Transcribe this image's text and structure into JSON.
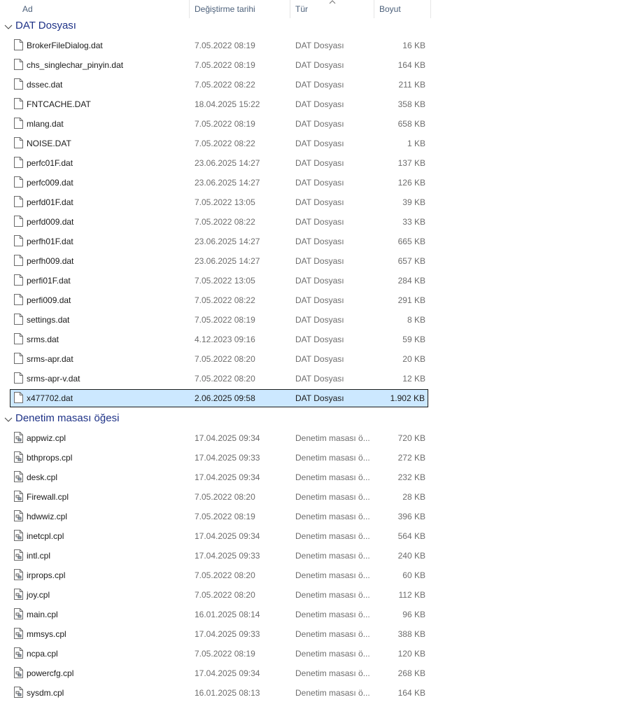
{
  "header": {
    "columns": [
      {
        "label": "Ad"
      },
      {
        "label": "Değiştirme tarihi"
      },
      {
        "label": "Tür"
      },
      {
        "label": "Boyut"
      }
    ]
  },
  "groups": [
    {
      "title": "DAT Dosyası",
      "icon": "file-icon",
      "files": [
        {
          "name": "BrokerFileDialog.dat",
          "date": "7.05.2022 08:19",
          "type": "DAT Dosyası",
          "size": "16 KB"
        },
        {
          "name": "chs_singlechar_pinyin.dat",
          "date": "7.05.2022 08:19",
          "type": "DAT Dosyası",
          "size": "164 KB"
        },
        {
          "name": "dssec.dat",
          "date": "7.05.2022 08:22",
          "type": "DAT Dosyası",
          "size": "211 KB"
        },
        {
          "name": "FNTCACHE.DAT",
          "date": "18.04.2025 15:22",
          "type": "DAT Dosyası",
          "size": "358 KB"
        },
        {
          "name": "mlang.dat",
          "date": "7.05.2022 08:19",
          "type": "DAT Dosyası",
          "size": "658 KB"
        },
        {
          "name": "NOISE.DAT",
          "date": "7.05.2022 08:22",
          "type": "DAT Dosyası",
          "size": "1 KB"
        },
        {
          "name": "perfc01F.dat",
          "date": "23.06.2025 14:27",
          "type": "DAT Dosyası",
          "size": "137 KB"
        },
        {
          "name": "perfc009.dat",
          "date": "23.06.2025 14:27",
          "type": "DAT Dosyası",
          "size": "126 KB"
        },
        {
          "name": "perfd01F.dat",
          "date": "7.05.2022 13:05",
          "type": "DAT Dosyası",
          "size": "39 KB"
        },
        {
          "name": "perfd009.dat",
          "date": "7.05.2022 08:22",
          "type": "DAT Dosyası",
          "size": "33 KB"
        },
        {
          "name": "perfh01F.dat",
          "date": "23.06.2025 14:27",
          "type": "DAT Dosyası",
          "size": "665 KB"
        },
        {
          "name": "perfh009.dat",
          "date": "23.06.2025 14:27",
          "type": "DAT Dosyası",
          "size": "657 KB"
        },
        {
          "name": "perfi01F.dat",
          "date": "7.05.2022 13:05",
          "type": "DAT Dosyası",
          "size": "284 KB"
        },
        {
          "name": "perfi009.dat",
          "date": "7.05.2022 08:22",
          "type": "DAT Dosyası",
          "size": "291 KB"
        },
        {
          "name": "settings.dat",
          "date": "7.05.2022 08:19",
          "type": "DAT Dosyası",
          "size": "8 KB"
        },
        {
          "name": "srms.dat",
          "date": "4.12.2023 09:16",
          "type": "DAT Dosyası",
          "size": "59 KB"
        },
        {
          "name": "srms-apr.dat",
          "date": "7.05.2022 08:20",
          "type": "DAT Dosyası",
          "size": "20 KB"
        },
        {
          "name": "srms-apr-v.dat",
          "date": "7.05.2022 08:20",
          "type": "DAT Dosyası",
          "size": "12 KB"
        },
        {
          "name": "x477702.dat",
          "date": "2.06.2025 09:58",
          "type": "DAT Dosyası",
          "size": "1.902 KB",
          "selected": true
        }
      ]
    },
    {
      "title": "Denetim masası öğesi",
      "icon": "control-panel-file-icon",
      "files": [
        {
          "name": "appwiz.cpl",
          "date": "17.04.2025 09:34",
          "type": "Denetim masası ö...",
          "size": "720 KB"
        },
        {
          "name": "bthprops.cpl",
          "date": "17.04.2025 09:33",
          "type": "Denetim masası ö...",
          "size": "272 KB"
        },
        {
          "name": "desk.cpl",
          "date": "17.04.2025 09:34",
          "type": "Denetim masası ö...",
          "size": "232 KB"
        },
        {
          "name": "Firewall.cpl",
          "date": "7.05.2022 08:20",
          "type": "Denetim masası ö...",
          "size": "28 KB"
        },
        {
          "name": "hdwwiz.cpl",
          "date": "7.05.2022 08:19",
          "type": "Denetim masası ö...",
          "size": "396 KB"
        },
        {
          "name": "inetcpl.cpl",
          "date": "17.04.2025 09:34",
          "type": "Denetim masası ö...",
          "size": "564 KB"
        },
        {
          "name": "intl.cpl",
          "date": "17.04.2025 09:33",
          "type": "Denetim masası ö...",
          "size": "240 KB"
        },
        {
          "name": "irprops.cpl",
          "date": "7.05.2022 08:20",
          "type": "Denetim masası ö...",
          "size": "60 KB"
        },
        {
          "name": "joy.cpl",
          "date": "7.05.2022 08:20",
          "type": "Denetim masası ö...",
          "size": "112 KB"
        },
        {
          "name": "main.cpl",
          "date": "16.01.2025 08:14",
          "type": "Denetim masası ö...",
          "size": "96 KB"
        },
        {
          "name": "mmsys.cpl",
          "date": "17.04.2025 09:33",
          "type": "Denetim masası ö...",
          "size": "388 KB"
        },
        {
          "name": "ncpa.cpl",
          "date": "7.05.2022 08:19",
          "type": "Denetim masası ö...",
          "size": "120 KB"
        },
        {
          "name": "powercfg.cpl",
          "date": "17.04.2025 09:34",
          "type": "Denetim masası ö...",
          "size": "268 KB"
        },
        {
          "name": "sysdm.cpl",
          "date": "16.01.2025 08:13",
          "type": "Denetim masası ö...",
          "size": "164 KB"
        }
      ]
    }
  ],
  "colors": {
    "group_title": "#1e3287",
    "selection_bg": "#cce8ff",
    "header_text": "#4c607a",
    "meta_text": "#6d6d6d"
  }
}
